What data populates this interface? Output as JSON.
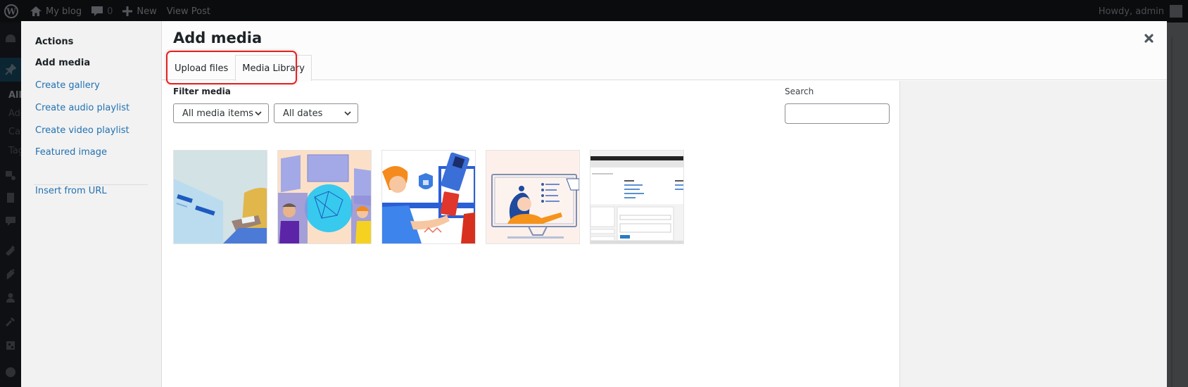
{
  "admin_bar": {
    "site_name": "My blog",
    "comments_count": "0",
    "new_label": "New",
    "view_post_label": "View Post",
    "greeting": "Howdy, admin"
  },
  "admin_menu": {
    "submenu": [
      "All",
      "Add",
      "Cat",
      "Tag"
    ]
  },
  "modal": {
    "menu_heading": "Actions",
    "menu_items": [
      {
        "label": "Add media",
        "active": true
      },
      {
        "label": "Create gallery",
        "active": false
      },
      {
        "label": "Create audio playlist",
        "active": false
      },
      {
        "label": "Create video playlist",
        "active": false
      },
      {
        "label": "Featured image",
        "active": false
      },
      {
        "label": "Insert from URL",
        "active": false
      }
    ],
    "title": "Add media",
    "tabs": [
      {
        "label": "Upload files",
        "active": false
      },
      {
        "label": "Media Library",
        "active": true
      }
    ],
    "filter": {
      "label": "Filter media",
      "type_select": "All media items",
      "date_select": "All dates"
    },
    "search": {
      "label": "Search",
      "value": ""
    },
    "attachments": [
      {
        "icon": "illustration-person-at-desk-thumbnail"
      },
      {
        "icon": "illustration-globe-network-thumbnail"
      },
      {
        "icon": "illustration-online-payment-thumbnail"
      },
      {
        "icon": "illustration-online-teacher-thumbnail"
      },
      {
        "icon": "screenshot-dashboard-thumbnail"
      }
    ]
  },
  "colors": {
    "link": "#2271b1",
    "highlight_ring": "#e02424",
    "admin_bar": "#0b0c0e"
  }
}
